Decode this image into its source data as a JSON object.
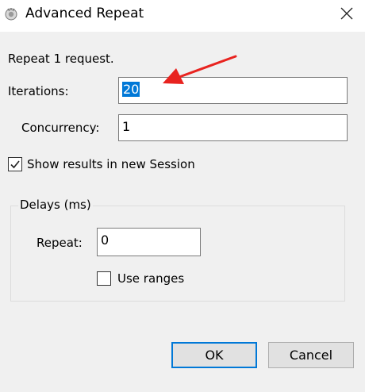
{
  "window": {
    "title": "Advanced Repeat",
    "app_icon": "fiddler-app-icon",
    "close_icon": "close-icon"
  },
  "dialog": {
    "description": "Repeat 1 request.",
    "iterations": {
      "label": "Iterations:",
      "value": "20"
    },
    "concurrency": {
      "label": "Concurrency:",
      "value": "1"
    },
    "show_results": {
      "label": "Show results in new Session",
      "checked": true
    },
    "delays": {
      "title": "Delays (ms)",
      "repeat": {
        "label": "Repeat:",
        "value": "0"
      },
      "use_ranges": {
        "label": "Use ranges",
        "checked": false
      }
    },
    "ok_label": "OK",
    "cancel_label": "Cancel"
  },
  "colors": {
    "selection": "#0078d7",
    "annotation_arrow": "#e8231f",
    "dialog_background": "#f0f0f0",
    "default_button_border": "#0078d7"
  }
}
